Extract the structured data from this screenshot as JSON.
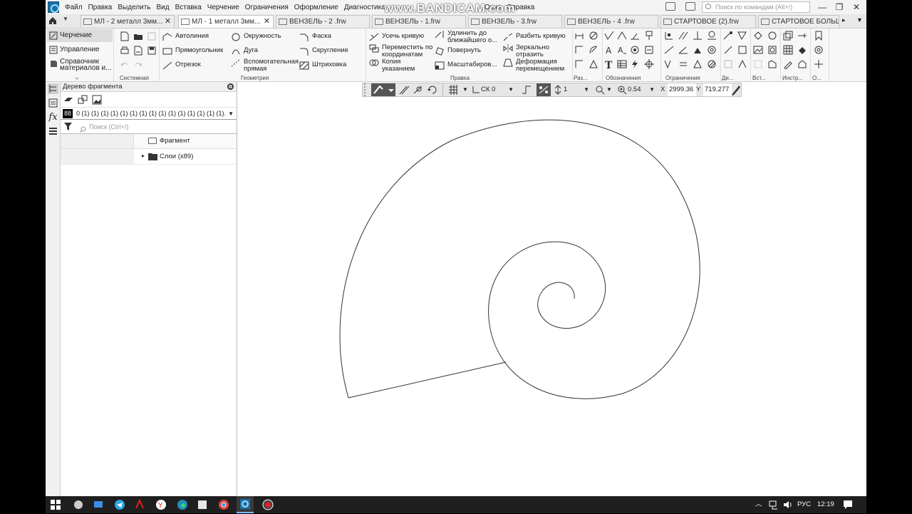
{
  "menu": {
    "items": [
      "Файл",
      "Правка",
      "Выделить",
      "Вид",
      "Вставка",
      "Черчение",
      "Ограничения",
      "Оформление",
      "Диагностика",
      "Окно",
      "Справка"
    ],
    "search_placeholder": "Поиск по командам (Alt+/)"
  },
  "watermark": "www.BANDICAM.com",
  "tabs": [
    {
      "label": "МЛ - 2 металл 3мм...",
      "close": "✕",
      "active": false
    },
    {
      "label": "МЛ - 1 металл 3мм...",
      "close": "✕",
      "active": true
    },
    {
      "label": "ВЕНЗЕЛЬ - 2 .frw",
      "close": "",
      "active": false
    },
    {
      "label": "ВЕНЗЕЛЬ - 1.frw",
      "close": "",
      "active": false
    },
    {
      "label": "ВЕНЗЕЛЬ - 3.frw",
      "close": "",
      "active": false
    },
    {
      "label": "ВЕНЗЕЛЬ - 4 .frw",
      "close": "",
      "active": false
    },
    {
      "label": "СТАРТОВОЕ  (2).frw",
      "close": "",
      "active": false
    },
    {
      "label": "СТАРТОВОЕ БОЛЬШ...",
      "close": "",
      "active": false
    }
  ],
  "ribbon": {
    "modes": [
      "Черчение",
      "Управление",
      "Справочник материалов и..."
    ],
    "system_label": "Системная",
    "geometry": {
      "label": "Геометрия",
      "col1": [
        "Автолиния",
        "Прямоугольник",
        "Отрезок"
      ],
      "col2": [
        "Окружность",
        "Дуга",
        "Вспомогательная прямая"
      ],
      "col3": [
        "Фаска",
        "Скругление",
        "Штриховка"
      ]
    },
    "edit": {
      "label": "Правка",
      "col1": [
        "Усечь кривую",
        "Переместить по координатам",
        "Копия указанием"
      ],
      "col2": [
        "Удлинить до ближайшего о...",
        "Повернуть",
        "Масштабиров..."
      ],
      "col3": [
        "Разбить кривую",
        "Зеркально отразить",
        "Деформация перемещением"
      ]
    },
    "groups": [
      "Раз...",
      "Обозначения",
      "Ограничения",
      "Ди...",
      "Вст...",
      "Инстр...",
      "О..."
    ]
  },
  "tree": {
    "title": "Дерево фрагмента",
    "layer_badge": "88",
    "layer_list": "0 (1) (1) (1) (1) (1) (1) (1) (1) (1) (1) (1) (1) (1) (1) (1)...",
    "search_placeholder": "Поиск (Ctrl+/)",
    "column_header": "Фрагмент",
    "row_label": "Слои (x89)"
  },
  "drawbar": {
    "cs": "СК 0",
    "step": "1",
    "zoom": "0.54",
    "x_label": "X",
    "x_value": "2999.36",
    "y_label": "Y",
    "y_value": "719.277"
  },
  "taskbar": {
    "lang": "РУС",
    "time": "12:19"
  },
  "colors": {
    "accent": "#1c6fa6",
    "taskbar": "#1f1f1f",
    "line": "#333333"
  }
}
